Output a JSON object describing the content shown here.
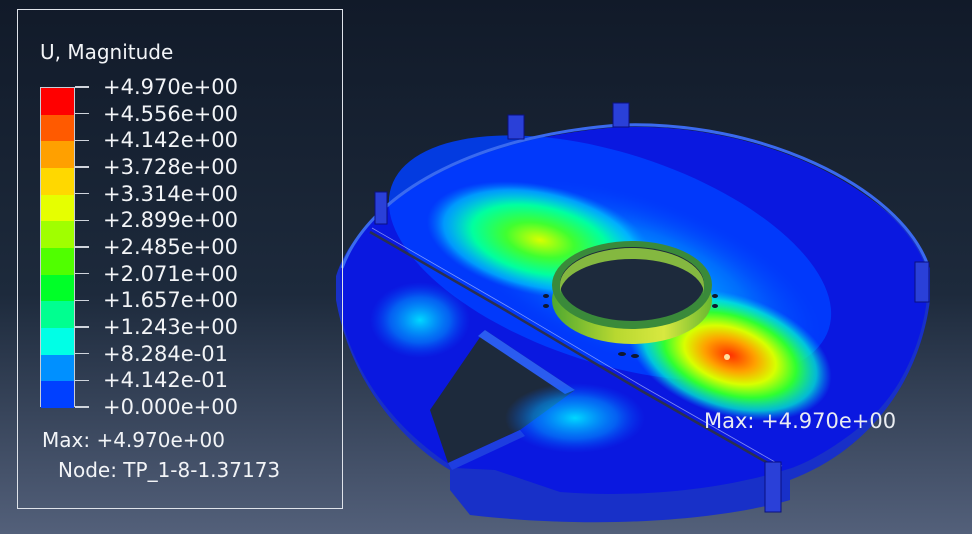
{
  "legend": {
    "title": "U, Magnitude",
    "labels": [
      "+4.970e+00",
      "+4.556e+00",
      "+4.142e+00",
      "+3.728e+00",
      "+3.314e+00",
      "+2.899e+00",
      "+2.485e+00",
      "+2.071e+00",
      "+1.657e+00",
      "+1.243e+00",
      "+8.284e-01",
      "+4.142e-01",
      "+0.000e+00"
    ],
    "colors": [
      "#ff0000",
      "#ff5a00",
      "#ffa000",
      "#ffd800",
      "#e6ff00",
      "#a0ff00",
      "#50ff00",
      "#00ff28",
      "#00ff90",
      "#00ffe6",
      "#0090ff",
      "#0040ff",
      "#0000ff"
    ],
    "max_line": "Max: +4.970e+00",
    "node_line": "Node: TP_1-8-1.37173"
  },
  "viewport": {
    "max_annotation": "Max: +4.970e+00"
  }
}
